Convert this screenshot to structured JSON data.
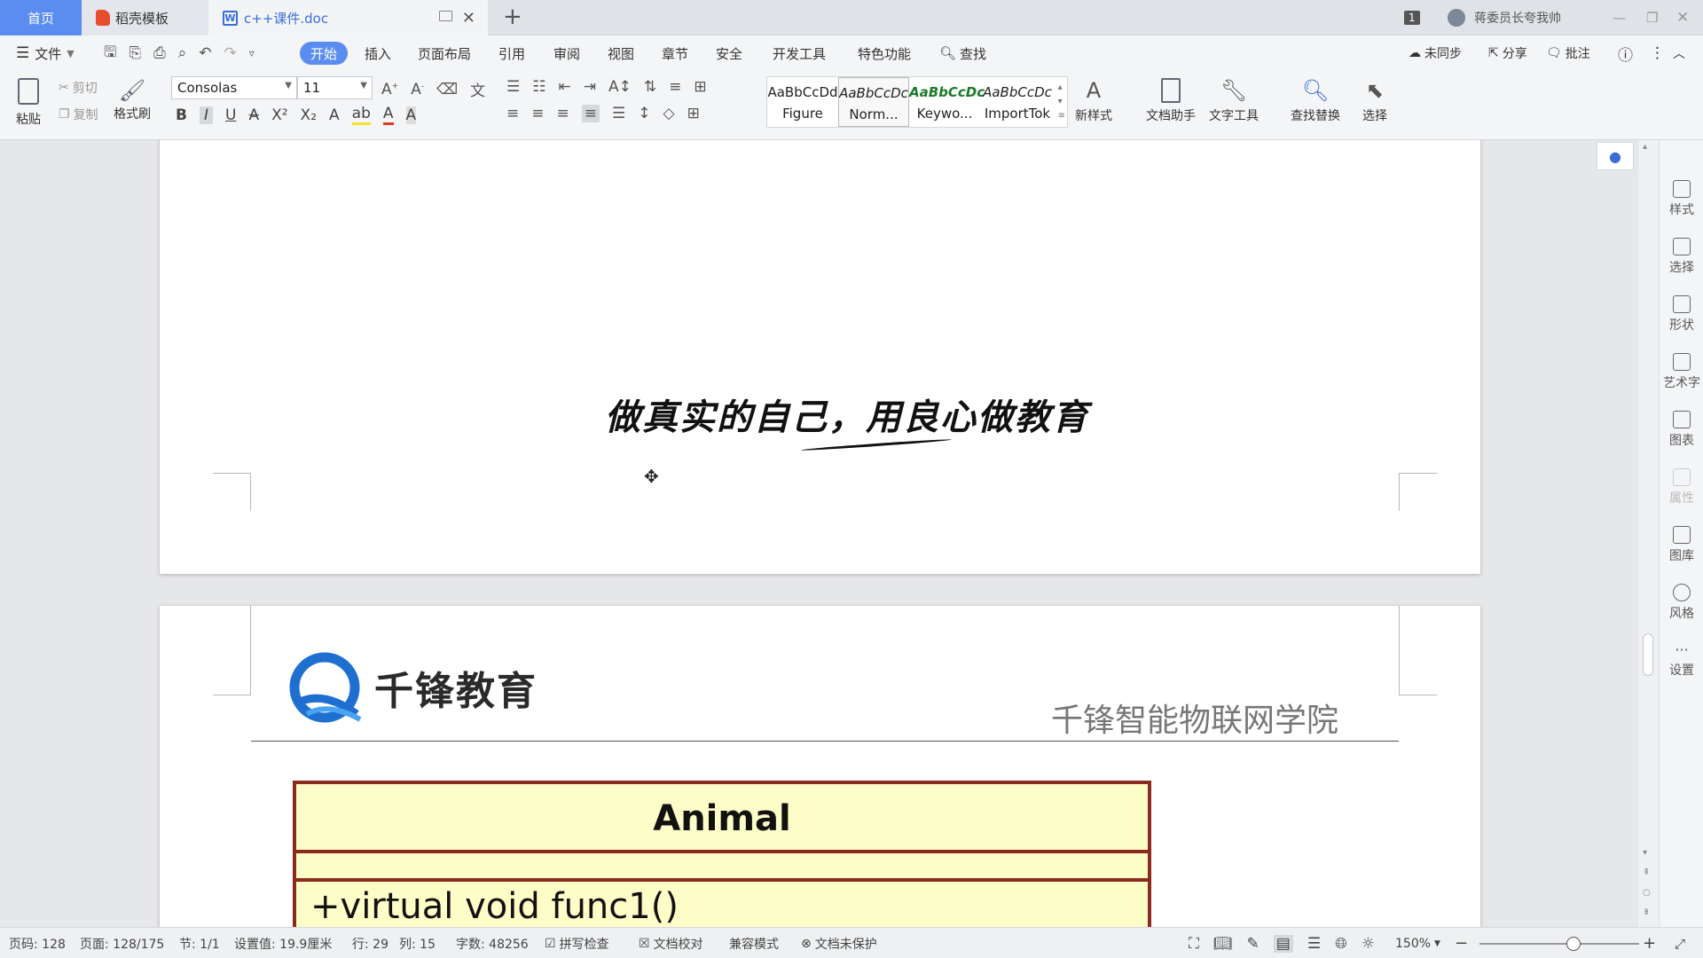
{
  "tabs": {
    "home": "首页",
    "template": "稻壳模板",
    "doc": "c++课件.doc",
    "add": "+",
    "close": "✕"
  },
  "titlebar": {
    "badge": "1",
    "user": "蒋委员长夸我帅"
  },
  "menu": {
    "file": "文件",
    "items": [
      "开始",
      "插入",
      "页面布局",
      "引用",
      "审阅",
      "视图",
      "章节",
      "安全",
      "开发工具",
      "特色功能"
    ],
    "search": "查找",
    "sync": "未同步",
    "share": "分享",
    "comment": "批注"
  },
  "ribbon": {
    "paste": "粘贴",
    "cut": "剪切",
    "copy": "复制",
    "format_painter": "格式刷",
    "font_name": "Consolas",
    "font_size": "11",
    "styles": [
      {
        "preview": "AaBbCcDd",
        "name": "Figure"
      },
      {
        "preview": "AaBbCcDc",
        "name": "Norm..."
      },
      {
        "preview": "AaBbCcDc",
        "name": "Keywo..."
      },
      {
        "preview": "AaBbCcDc",
        "name": "ImportTok"
      }
    ],
    "new_style": "新样式",
    "doc_assistant": "文档助手",
    "text_tools": "文字工具",
    "find_replace": "查找替换",
    "select": "选择"
  },
  "sidepanel": [
    "样式",
    "选择",
    "形状",
    "艺术字",
    "图表",
    "属性",
    "图库",
    "风格",
    "设置"
  ],
  "document": {
    "slogan": "做真实的自己，用良心做教育",
    "logo_text": "千锋教育",
    "header_right": "千锋智能物联网学院",
    "uml_class": "Animal",
    "uml_method": "+virtual void func1()"
  },
  "status": {
    "page_code": "页码: 128",
    "pages": "页面: 128/175",
    "section": "节: 1/1",
    "setting": "设置值: 19.9厘米",
    "row": "行: 29",
    "col": "列: 15",
    "words": "字数: 48256",
    "spell": "拼写检查",
    "proof": "文档校对",
    "compat": "兼容模式",
    "protect": "文档未保护",
    "zoom": "150%"
  },
  "colors": {
    "accent": "#5b8df0",
    "uml_border": "#8b2a1e",
    "uml_fill": "#fdfdc7"
  }
}
